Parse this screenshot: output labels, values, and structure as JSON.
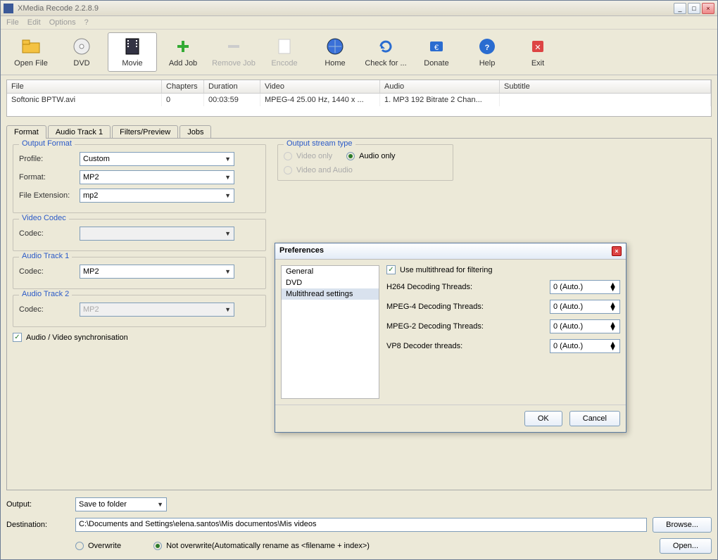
{
  "title": "XMedia Recode 2.2.8.9",
  "menu": [
    "File",
    "Edit",
    "Options",
    "?"
  ],
  "toolbar": [
    {
      "label": "Open File",
      "icon": "folder"
    },
    {
      "label": "DVD",
      "icon": "disc"
    },
    {
      "label": "Movie",
      "icon": "film",
      "sel": true
    },
    {
      "label": "Add Job",
      "icon": "plus"
    },
    {
      "label": "Remove Job",
      "icon": "minus",
      "dis": true
    },
    {
      "label": "Encode",
      "icon": "page",
      "dis": true
    },
    {
      "label": "Home",
      "icon": "globe"
    },
    {
      "label": "Check for ...",
      "icon": "refresh"
    },
    {
      "label": "Donate",
      "icon": "donate"
    },
    {
      "label": "Help",
      "icon": "help"
    },
    {
      "label": "Exit",
      "icon": "exit"
    }
  ],
  "list": {
    "headers": [
      "File",
      "Chapters",
      "Duration",
      "Video",
      "Audio",
      "Subtitle"
    ],
    "row": {
      "file": "Softonic BPTW.avi",
      "chapters": "0",
      "duration": "00:03:59",
      "video": "MPEG-4 25.00 Hz, 1440 x ...",
      "audio": "1. MP3 192 Bitrate 2 Chan...",
      "subtitle": ""
    }
  },
  "tabs": [
    "Format",
    "Audio Track 1",
    "Filters/Preview",
    "Jobs"
  ],
  "outputFormat": {
    "legend": "Output Format",
    "profile_lbl": "Profile:",
    "profile": "Custom",
    "format_lbl": "Format:",
    "format": "MP2",
    "ext_lbl": "File Extension:",
    "ext": "mp2"
  },
  "streamType": {
    "legend": "Output stream type",
    "options": [
      "Video only",
      "Audio only",
      "Video and Audio"
    ],
    "selected": 1
  },
  "videoCodec": {
    "legend": "Video Codec",
    "codec_lbl": "Codec:",
    "codec": ""
  },
  "audio1": {
    "legend": "Audio Track 1",
    "codec_lbl": "Codec:",
    "codec": "MP2"
  },
  "audio2": {
    "legend": "Audio Track 2",
    "codec_lbl": "Codec:",
    "codec": "MP2"
  },
  "avsync": "Audio / Video synchronisation",
  "output": {
    "out_lbl": "Output:",
    "out_val": "Save to folder",
    "dest_lbl": "Destination:",
    "dest_val": "C:\\Documents and Settings\\elena.santos\\Mis documentos\\Mis videos",
    "browse": "Browse...",
    "open": "Open...",
    "overwrite": "Overwrite",
    "notoverwrite": "Not overwrite(Automatically rename as <filename + index>)"
  },
  "pref": {
    "title": "Preferences",
    "side": [
      "General",
      "DVD",
      "Multithread settings"
    ],
    "chk": "Use multithread for filtering",
    "rows": [
      {
        "lbl": "H264 Decoding Threads:",
        "val": "0 (Auto.)"
      },
      {
        "lbl": "MPEG-4 Decoding Threads:",
        "val": "0 (Auto.)"
      },
      {
        "lbl": "MPEG-2 Decoding Threads:",
        "val": "0 (Auto.)"
      },
      {
        "lbl": "VP8 Decoder threads:",
        "val": "0 (Auto.)"
      }
    ],
    "ok": "OK",
    "cancel": "Cancel"
  }
}
